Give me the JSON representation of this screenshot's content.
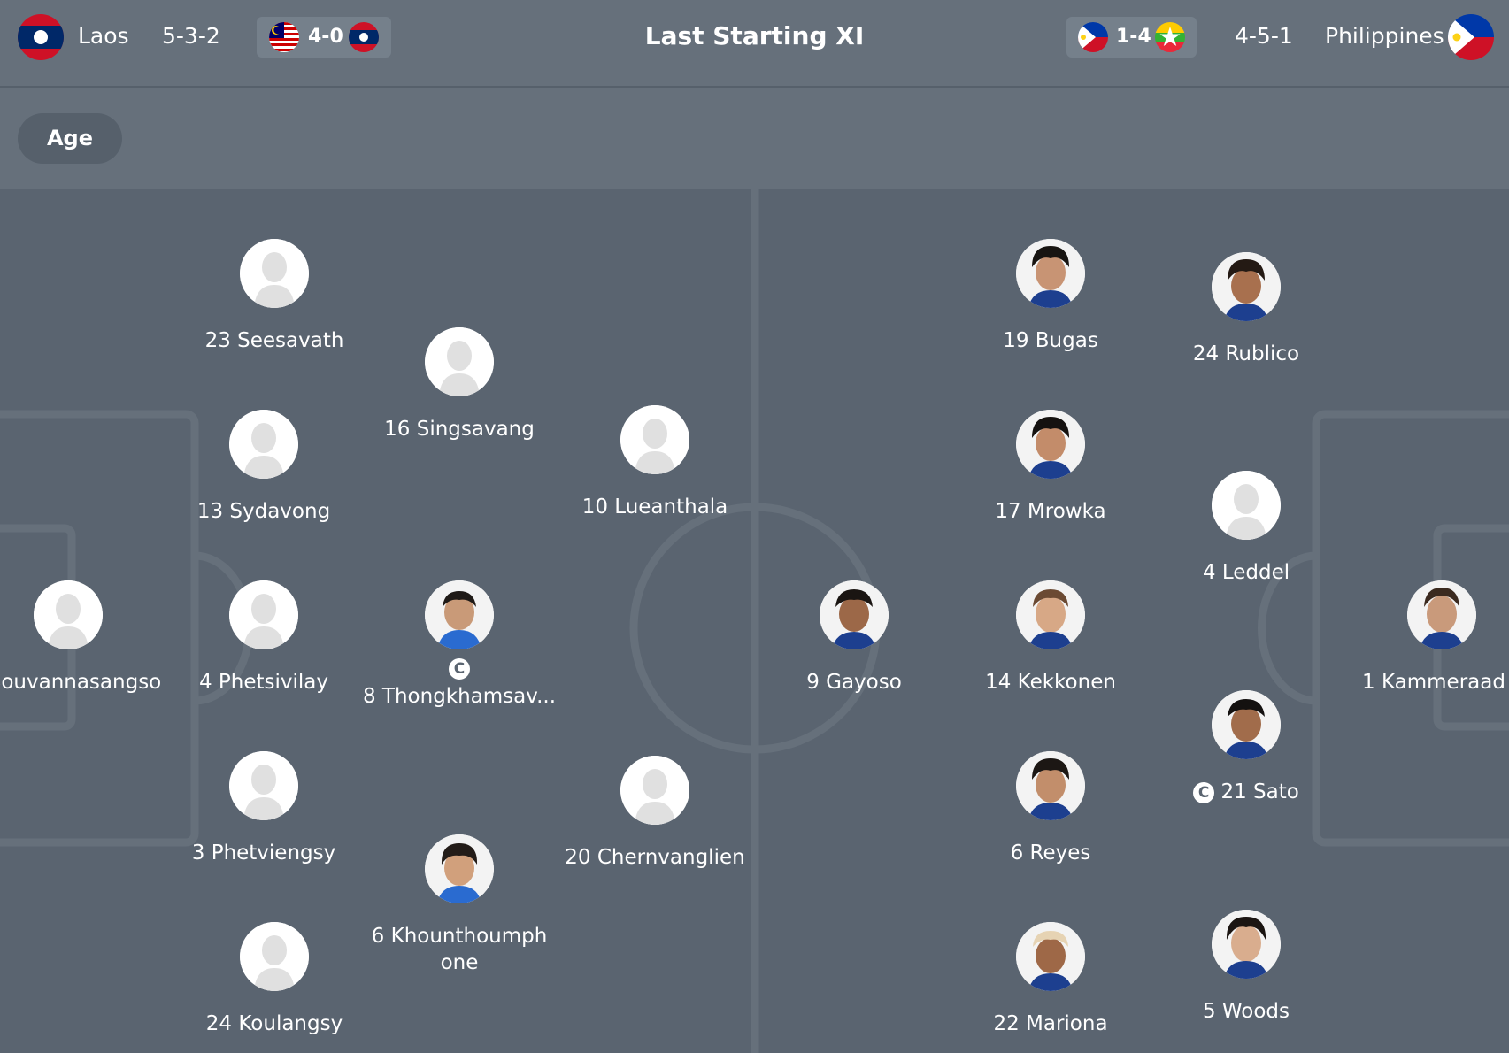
{
  "header": {
    "home": {
      "name": "Laos",
      "formation": "5-3-2",
      "flag_icon": "laos-flag-icon"
    },
    "home_last": {
      "score": "4-0",
      "left_flag_icon": "malaysia-flag-icon",
      "right_flag_icon": "laos-flag-icon"
    },
    "title": "Last Starting XI",
    "away_last": {
      "score": "1-4",
      "left_flag_icon": "philippines-flag-icon",
      "right_flag_icon": "myanmar-flag-icon"
    },
    "away": {
      "name": "Philippines",
      "formation": "4-5-1",
      "flag_icon": "philippines-flag-icon"
    }
  },
  "toolbar": {
    "age_label": "Age"
  },
  "captain_badge": "C",
  "home_players": [
    {
      "number_name": "23 Seesavath",
      "photo": false
    },
    {
      "number_name": "16 Singsavang",
      "photo": false
    },
    {
      "number_name": "13 Sydavong",
      "photo": false
    },
    {
      "number_name": "10 Lueanthala",
      "photo": false
    },
    {
      "number_name": "Souvannasangso",
      "photo": false
    },
    {
      "number_name": "4 Phetsivilay",
      "photo": false
    },
    {
      "number_name": "8 Thongkhamsav...",
      "photo": true,
      "captain": true
    },
    {
      "number_name": "3 Phetviengsy",
      "photo": false
    },
    {
      "number_name": "20 Chernvanglien",
      "photo": false
    },
    {
      "number_name": "6 Khounthoumph one",
      "photo": true
    },
    {
      "number_name": "24 Koulangsy",
      "photo": false
    }
  ],
  "away_players": [
    {
      "number_name": "19 Bugas",
      "photo": true
    },
    {
      "number_name": "24 Rublico",
      "photo": true
    },
    {
      "number_name": "17 Mrowka",
      "photo": true
    },
    {
      "number_name": "4 Leddel",
      "photo": false
    },
    {
      "number_name": "9 Gayoso",
      "photo": true
    },
    {
      "number_name": "14 Kekkonen",
      "photo": true
    },
    {
      "number_name": "1 Kammeraad",
      "photo": true
    },
    {
      "number_name": "21 Sato",
      "photo": true,
      "captain": true
    },
    {
      "number_name": "6 Reyes",
      "photo": true
    },
    {
      "number_name": "22 Mariona",
      "photo": true
    },
    {
      "number_name": "5 Woods",
      "photo": true
    }
  ]
}
